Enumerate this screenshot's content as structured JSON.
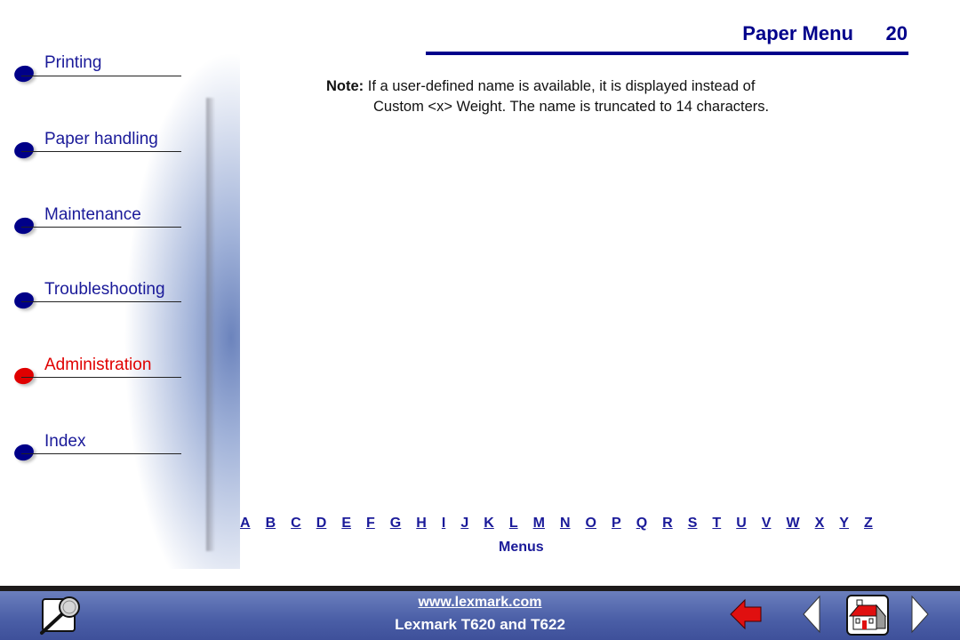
{
  "header": {
    "title": "Paper Menu",
    "page_number": "20"
  },
  "sidebar": {
    "items": [
      {
        "label": "Printing",
        "active": false
      },
      {
        "label": "Paper handling",
        "active": false
      },
      {
        "label": "Maintenance",
        "active": false
      },
      {
        "label": "Troubleshooting",
        "active": false
      },
      {
        "label": "Administration",
        "active": true
      },
      {
        "label": "Index",
        "active": false
      }
    ]
  },
  "note": {
    "label": "Note:",
    "line1": "If a user-defined name is available, it is displayed instead of",
    "line2": "Custom <x> Weight. The name is truncated to 14 characters."
  },
  "alphabet": [
    "A",
    "B",
    "C",
    "D",
    "E",
    "F",
    "G",
    "H",
    "I",
    "J",
    "K",
    "L",
    "M",
    "N",
    "O",
    "P",
    "Q",
    "R",
    "S",
    "T",
    "U",
    "V",
    "W",
    "X",
    "Y",
    "Z"
  ],
  "menus_link": "Menus",
  "footer": {
    "url": "www.lexmark.com",
    "product": "Lexmark T620 and T622",
    "icons": {
      "search": "magnifier-icon",
      "back": "back-arrow-icon",
      "prev": "previous-page-icon",
      "home": "home-icon",
      "next": "next-page-icon"
    }
  },
  "colors": {
    "accent": "#00008b",
    "active": "#e00000",
    "footer": "#4a5ea6"
  }
}
